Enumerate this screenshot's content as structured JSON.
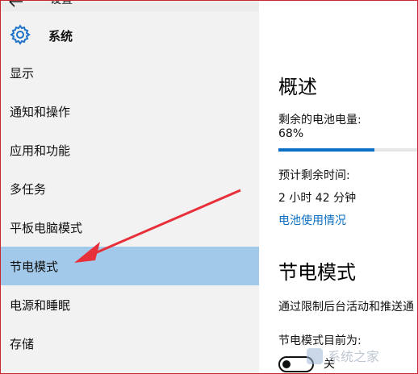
{
  "window": {
    "title": "设置"
  },
  "header": {
    "title": "系统",
    "icon": "gear-icon"
  },
  "sidebar": {
    "items": [
      {
        "label": "显示"
      },
      {
        "label": "通知和操作"
      },
      {
        "label": "应用和功能"
      },
      {
        "label": "多任务"
      },
      {
        "label": "平板电脑模式"
      },
      {
        "label": "节电模式",
        "selected": true
      },
      {
        "label": "电源和睡眠"
      },
      {
        "label": "存储"
      }
    ]
  },
  "main": {
    "overview_title": "概述",
    "battery_label": "剩余的电池电量:",
    "battery_percent": "68%",
    "battery_level": 0.68,
    "time_label": "预计剩余时间:",
    "time_value": "2 小时 42 分钟",
    "battery_usage_link": "电池使用情况",
    "saver_title": "节电模式",
    "saver_desc": "通过限制后台活动和推送通",
    "saver_status_label": "节电模式目前为:",
    "toggle_state": "关"
  },
  "colors": {
    "accent": "#0c6fc6",
    "selected_bg": "#a3c9ea",
    "sidebar_bg": "#f2f2f2",
    "arrow": "#e8303a"
  }
}
